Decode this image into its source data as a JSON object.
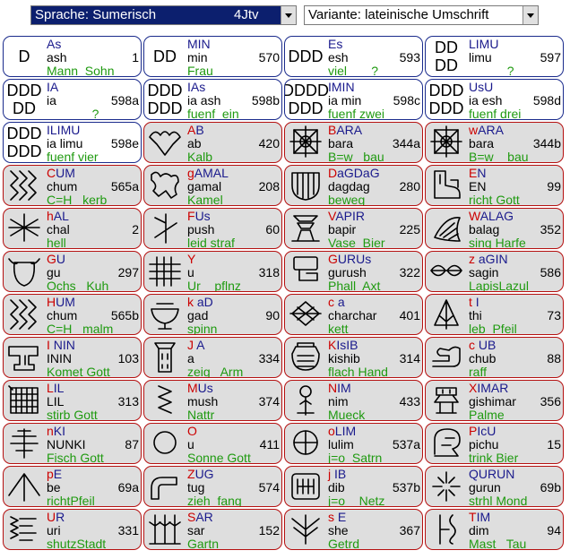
{
  "toolbar": {
    "language_select": {
      "value": "Sprache: Sumerisch",
      "code": "4Jtv"
    },
    "variant_select": {
      "value": "Variante: lateinische Umschrift"
    }
  },
  "cards": [
    {
      "style": "blue",
      "glyph_text": "D",
      "l1": "As",
      "l1_marked": false,
      "l2": "ash",
      "num": "1",
      "l3": "Mann  Sohn"
    },
    {
      "style": "blue",
      "glyph_text": "DD",
      "l1": "MIN",
      "l1_marked": false,
      "l2": "min",
      "num": "570",
      "l3": "Frau"
    },
    {
      "style": "blue",
      "glyph_text": "DDD",
      "l1": "Es",
      "l1_marked": false,
      "l2": "esh",
      "num": "593",
      "l3": "viel       ?"
    },
    {
      "style": "blue",
      "glyph_text": "DD\nDD",
      "l1": "LIMU",
      "l1_marked": false,
      "l2": "limu",
      "num": "597",
      "l3": "           ?"
    },
    {
      "style": "blue",
      "glyph_text": "DDD\nDD",
      "l1": "IA",
      "l1_marked": false,
      "l2": "ia",
      "num": "598a",
      "l3": "             ?"
    },
    {
      "style": "blue",
      "glyph_text": "DDD\nDDD",
      "l1": "IAs",
      "l1_marked": false,
      "l2": "ia ash",
      "num": "598b",
      "l3": "fuenf  ein"
    },
    {
      "style": "blue",
      "glyph_text": "DDDD\nDDD",
      "l1": "IMIN",
      "l1_marked": false,
      "l2": "ia min",
      "num": "598c",
      "l3": "fuenf zwei"
    },
    {
      "style": "blue",
      "glyph_text": "DDD\nDDD",
      "l1": "UsU",
      "l1_marked": false,
      "l2": "ia esh",
      "num": "598d",
      "l3": "fuenf drei"
    },
    {
      "style": "blue",
      "glyph_text": "DDD\nDDD",
      "l1": "ILIMU",
      "l1_marked": false,
      "l2": "ia limu",
      "num": "598e",
      "l3": "fuenf vier"
    },
    {
      "style": "red",
      "glyph": "cloud",
      "l1": "AB",
      "l1_marked": true,
      "mk": "A",
      "rest": "B",
      "l2": "ab",
      "num": "420",
      "l3": "Kalb"
    },
    {
      "style": "red",
      "glyph": "box",
      "l1": "BARA",
      "l1_marked": true,
      "mk": "B",
      "rest": "ARA",
      "l2": "bara",
      "num": "344a",
      "l3": "B=w   bau"
    },
    {
      "style": "red",
      "glyph": "box",
      "l1": "wARA",
      "l1_marked": true,
      "mk": "w",
      "rest": "ARA",
      "l2": "bara",
      "num": "344b",
      "l3": "B=w    bau"
    },
    {
      "style": "red",
      "glyph": "zigzag",
      "l1": "CUM",
      "l1_marked": true,
      "mk": "C",
      "rest": "UM",
      "l2": "chum",
      "num": "565a",
      "l3": "C=H   kerb"
    },
    {
      "style": "red",
      "glyph": "camel",
      "l1": "gAMAL",
      "l1_marked": true,
      "mk": "g",
      "rest": "AMAL",
      "l2": "gamal",
      "num": "208",
      "l3": "Kamel"
    },
    {
      "style": "red",
      "glyph": "shield",
      "l1": "DaGDaG",
      "l1_marked": true,
      "mk": "D",
      "rest": "aGDaG",
      "l2": "dagdag",
      "num": "280",
      "l3": "beweg"
    },
    {
      "style": "red",
      "glyph": "boot",
      "l1": "EN",
      "l1_marked": true,
      "mk": "E",
      "rest": "N",
      "l2": "EN",
      "num": "99",
      "l3": "richt Gott"
    },
    {
      "style": "red",
      "glyph": "star",
      "l1": "hAL",
      "l1_marked": true,
      "mk": "h",
      "rest": "AL",
      "l2": "chal",
      "num": "2",
      "l3": "hell"
    },
    {
      "style": "red",
      "glyph": "plant",
      "l1": "FUs",
      "l1_marked": true,
      "mk": "F",
      "rest": "Us",
      "l2": "push",
      "num": "60",
      "l3": "leid straf"
    },
    {
      "style": "red",
      "glyph": "vase",
      "l1": "VAPIR",
      "l1_marked": true,
      "mk": "V",
      "rest": "APIR",
      "l2": "bapir",
      "num": "225",
      "l3": "Vase  Bier"
    },
    {
      "style": "red",
      "glyph": "harp",
      "l1": "WALAG",
      "l1_marked": true,
      "mk": "W",
      "rest": "ALAG",
      "l2": "balag",
      "num": "352",
      "l3": "sing Harfe"
    },
    {
      "style": "red",
      "glyph": "ox",
      "l1": "GU",
      "l1_marked": true,
      "mk": "G",
      "rest": "U",
      "l2": "gu",
      "num": "297",
      "l3": "Ochs   Kuh"
    },
    {
      "style": "red",
      "glyph": "hash",
      "l1": "Y",
      "l1_marked": true,
      "mk": "Y",
      "rest": "",
      "l2": "u",
      "num": "318",
      "l3": "Ur    pflnz"
    },
    {
      "style": "red",
      "glyph": "seal",
      "l1": "GURUs",
      "l1_marked": true,
      "mk": "G",
      "rest": "URUs",
      "l2": "gurush",
      "num": "322",
      "l3": "Phall  Axt"
    },
    {
      "style": "red",
      "glyph": "bow",
      "l1": "z aGIN",
      "l1_marked": true,
      "mk": "z",
      "rest": " aGIN",
      "l2": "sagin",
      "num": "586",
      "l3": "LapisLazul"
    },
    {
      "style": "red",
      "glyph": "zigzag",
      "l1": "HUM",
      "l1_marked": true,
      "mk": "H",
      "rest": "UM",
      "l2": "chum",
      "num": "565b",
      "l3": "C=H   malm"
    },
    {
      "style": "red",
      "glyph": "bowl",
      "l1": "k aD",
      "l1_marked": true,
      "mk": "k",
      "rest": " aD",
      "l2": "gad",
      "num": "90",
      "l3": "spinn"
    },
    {
      "style": "red",
      "glyph": "diamond",
      "l1": "c a",
      "l1_marked": true,
      "mk": "c",
      "rest": " a",
      "l2": "charchar",
      "num": "401",
      "l3": "kett"
    },
    {
      "style": "red",
      "glyph": "arrowup",
      "l1": "t I",
      "l1_marked": true,
      "mk": "t",
      "rest": " I",
      "l2": "thi",
      "num": "73",
      "l3": "leb  Pfeil"
    },
    {
      "style": "red",
      "glyph": "anvil",
      "l1": "I  NIN",
      "l1_marked": true,
      "mk": "I",
      "rest": "  NIN",
      "l2": "ININ",
      "num": "103",
      "l3": "Komet Gott"
    },
    {
      "style": "red",
      "glyph": "tower",
      "l1": "J A",
      "l1_marked": true,
      "mk": "J",
      "rest": " A",
      "l2": "a",
      "num": "334",
      "l3": "zeig   Arm"
    },
    {
      "style": "red",
      "glyph": "pot",
      "l1": "KIsIB",
      "l1_marked": true,
      "mk": "K",
      "rest": "IsIB",
      "l2": "kishib",
      "num": "314",
      "l3": "flach Hand"
    },
    {
      "style": "red",
      "glyph": "hand",
      "l1": "c UB",
      "l1_marked": true,
      "mk": "c",
      "rest": " UB",
      "l2": "chub",
      "num": "88",
      "l3": "raff"
    },
    {
      "style": "red",
      "glyph": "lattice",
      "l1": "LIL",
      "l1_marked": true,
      "mk": "L",
      "rest": "IL",
      "l2": "LIL",
      "num": "313",
      "l3": "stirb Gott"
    },
    {
      "style": "red",
      "glyph": "spiral",
      "l1": "MUs",
      "l1_marked": true,
      "mk": "M",
      "rest": "Us",
      "l2": "mush",
      "num": "374",
      "l3": "Nattr"
    },
    {
      "style": "red",
      "glyph": "onion",
      "l1": "NIM",
      "l1_marked": true,
      "mk": "N",
      "rest": "IM",
      "l2": "nim",
      "num": "433",
      "l3": "Mueck"
    },
    {
      "style": "red",
      "glyph": "gishimar",
      "l1": "XIMAR",
      "l1_marked": true,
      "mk": "X",
      "rest": "IMAR",
      "l2": "gishimar",
      "num": "356",
      "l3": "Palme"
    },
    {
      "style": "red",
      "glyph": "fish",
      "l1": "nKI",
      "l1_marked": true,
      "mk": "n",
      "rest": "KI",
      "l2": "NUNKI",
      "num": "87",
      "l3": "Fisch Gott"
    },
    {
      "style": "red",
      "glyph": "circle",
      "l1": "O",
      "l1_marked": true,
      "mk": "O",
      "rest": "",
      "l2": "u",
      "num": "411",
      "l3": "Sonne Gott"
    },
    {
      "style": "red",
      "glyph": "cross",
      "l1": "oLIM",
      "l1_marked": true,
      "mk": "o",
      "rest": "LIM",
      "l2": "lulim",
      "num": "537a",
      "l3": "j=o  Satrn"
    },
    {
      "style": "red",
      "glyph": "head",
      "l1": "PIcU",
      "l1_marked": true,
      "mk": "P",
      "rest": "IcU",
      "l2": "pichu",
      "num": "15",
      "l3": "trink Bier"
    },
    {
      "style": "red",
      "glyph": "caret",
      "l1": "pE",
      "l1_marked": true,
      "mk": "p",
      "rest": "E",
      "l2": "be",
      "num": "69a",
      "l3": "richtPfeil"
    },
    {
      "style": "red",
      "glyph": "pipe",
      "l1": "ZUG",
      "l1_marked": true,
      "mk": "Z",
      "rest": "UG",
      "l2": "tug",
      "num": "574",
      "l3": "zieh  fang"
    },
    {
      "style": "red",
      "glyph": "net",
      "l1": "j IB",
      "l1_marked": true,
      "mk": "j",
      "rest": " IB",
      "l2": "dib",
      "num": "537b",
      "l3": "j=o    Netz"
    },
    {
      "style": "red",
      "glyph": "burst",
      "l1": "QURUN",
      "l1_marked": false,
      "l2": "gurun",
      "num": "69b",
      "l3": "strhl Mond"
    },
    {
      "style": "red",
      "glyph": "uri",
      "l1": "UR",
      "l1_marked": true,
      "mk": "U",
      "rest": "R",
      "l2": "uri",
      "num": "331",
      "l3": "shutzStadt"
    },
    {
      "style": "red",
      "glyph": "garden",
      "l1": "SAR",
      "l1_marked": true,
      "mk": "S",
      "rest": "AR",
      "l2": "sar",
      "num": "152",
      "l3": "Gartn"
    },
    {
      "style": "red",
      "glyph": "grain",
      "l1": "s E",
      "l1_marked": true,
      "mk": "s",
      "rest": " E",
      "l2": "she",
      "num": "367",
      "l3": "Getrd"
    },
    {
      "style": "red",
      "glyph": "mast",
      "l1": "TIM",
      "l1_marked": true,
      "mk": "T",
      "rest": "IM",
      "l2": "dim",
      "num": "94",
      "l3": "Mast   Tau"
    }
  ]
}
